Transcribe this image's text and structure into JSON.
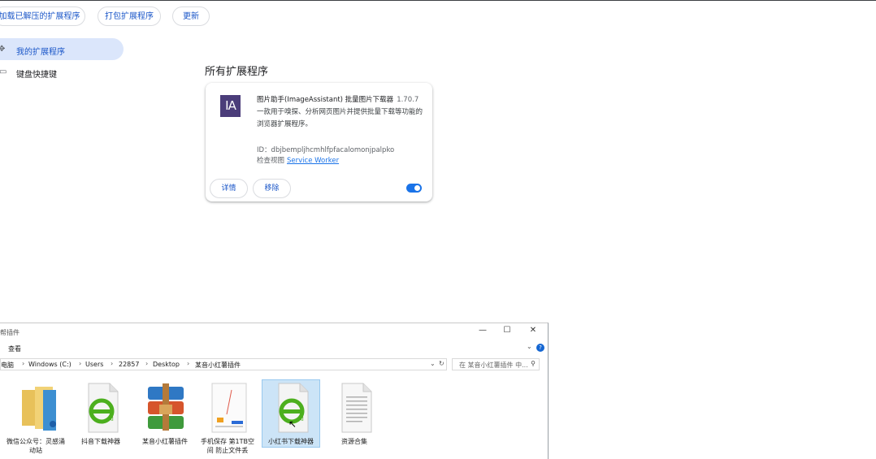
{
  "toolbar": {
    "load_unpacked": "加载已解压的扩展程序",
    "pack": "打包扩展程序",
    "update": "更新"
  },
  "sidebar": {
    "items": [
      {
        "label": "我的扩展程序",
        "icon": "puzzle-icon"
      },
      {
        "label": "键盘快捷键",
        "icon": "keyboard-icon"
      }
    ]
  },
  "main": {
    "section_title": "所有扩展程序"
  },
  "extension": {
    "logo_text": "IA",
    "name": "图片助手(ImageAssistant) 批量图片下载器",
    "version": "1.70.7",
    "description": "一款用于嗅探、分析网页图片并提供批量下载等功能的浏览器扩展程序。",
    "id": "ID：dbjbempljhcmhlfpfacalomonjpalpko",
    "inspect_label": "检查视图",
    "inspect_link": "Service Worker",
    "details_btn": "详情",
    "remove_btn": "移除",
    "enabled": true
  },
  "explorer": {
    "title": "帮插件",
    "menu": "查看",
    "breadcrumbs": [
      "电脑",
      "Windows (C:)",
      "Users",
      "22857",
      "Desktop",
      "某音小红薯插件"
    ],
    "search_placeholder": "在 某音小红薯插件 中...",
    "files": [
      {
        "label": "微信公众号：灵感涌动站",
        "icon": "folder-icon"
      },
      {
        "label": "抖音下载神器",
        "icon": "edge-html-icon"
      },
      {
        "label": "某音小红薯插件",
        "icon": "winrar-archive-icon"
      },
      {
        "label": "手机保存 第1TB空间 防止文件丢",
        "icon": "image-thumbnail-icon"
      },
      {
        "label": "小红书下载神器",
        "icon": "edge-html-icon",
        "selected": true
      },
      {
        "label": "资源合集",
        "icon": "text-document-icon"
      }
    ]
  },
  "colors": {
    "accent": "#1a73e8",
    "link": "#1a56c8",
    "sidebar_selected": "#dbe6fb",
    "logo_bg": "#4b3d7a",
    "file_selected": "#cce4f7"
  }
}
